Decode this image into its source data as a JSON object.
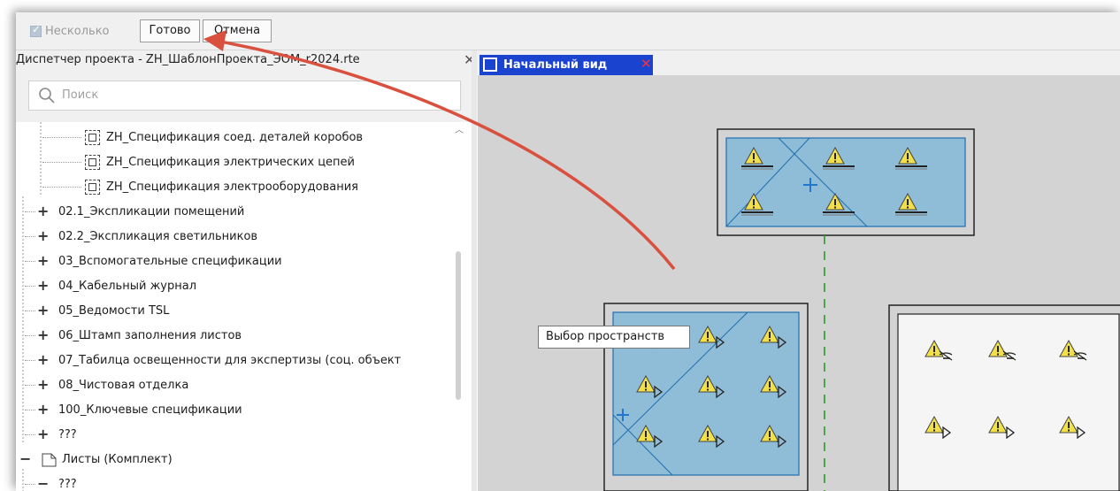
{
  "toolbar": {
    "multiple_label": "Несколько",
    "done_label": "Готово",
    "cancel_label": "Отмена"
  },
  "project_panel": {
    "title": "Диспетчер проекта - ZH_ШаблонПроекта_ЭОМ_r2024.rte",
    "search_placeholder": "Поиск",
    "items": [
      {
        "label": "ZH_Спецификация соед. деталей коробов"
      },
      {
        "label": "ZH_Спецификация электрических цепей"
      },
      {
        "label": "ZH_Спецификация электрооборудования"
      },
      {
        "label": "02.1_Экспликации помещений"
      },
      {
        "label": "02.2_Экспликация светильников"
      },
      {
        "label": "03_Вспомогательные спецификации"
      },
      {
        "label": "04_Кабельный журнал"
      },
      {
        "label": "05_Ведомости TSL"
      },
      {
        "label": "06_Штамп заполнения листов"
      },
      {
        "label": "07_Табилца освещенности для экспертизы (соц. объект"
      },
      {
        "label": "08_Чистовая отделка"
      },
      {
        "label": "100_Ключевые спецификации"
      },
      {
        "label": "???"
      },
      {
        "label": "Листы (Комплект)"
      },
      {
        "label": "???"
      }
    ]
  },
  "view": {
    "tab_label": "Начальный вид",
    "tooltip": "Выбор пространств"
  },
  "colors": {
    "tab_blue": "#1a43d0",
    "room_fill": "#8fbcd6",
    "arrow_red": "#d9503f",
    "warning_yellow": "#f2e04b"
  }
}
